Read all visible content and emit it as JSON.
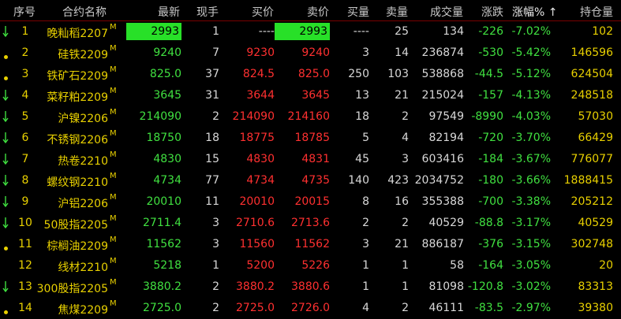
{
  "headers": {
    "seq": "序号",
    "name": "合约名称",
    "last": "最新",
    "vol_now": "现手",
    "bid": "买价",
    "ask": "卖价",
    "bid_vol": "买量",
    "ask_vol": "卖量",
    "volume": "成交量",
    "change": "涨跌",
    "pct": "涨幅%",
    "pct_sort_icon": "arrow-up-icon",
    "oi": "持仓量"
  },
  "colors": {
    "down": "#40e040",
    "up": "#ff3030",
    "label": "#e8d000",
    "neutral": "#d8d8d8"
  },
  "rows": [
    {
      "mark": "down-arrow",
      "seq": "1",
      "name": "晚籼稻2207",
      "flag": "M",
      "last": "2993",
      "last_hl": true,
      "vol_now": "1",
      "bid": "----",
      "ask": "2993",
      "ask_hl": true,
      "bid_vol": "----",
      "ask_vol": "25",
      "volume": "134",
      "change": "-226",
      "pct": "-7.02%",
      "oi": "102"
    },
    {
      "mark": "dot",
      "seq": "2",
      "name": "硅铁2209",
      "flag": "M",
      "last": "9240",
      "vol_now": "7",
      "bid": "9230",
      "ask": "9240",
      "bid_vol": "3",
      "ask_vol": "14",
      "volume": "236874",
      "change": "-530",
      "pct": "-5.42%",
      "oi": "146596"
    },
    {
      "mark": "dot",
      "seq": "3",
      "name": "铁矿石2209",
      "flag": "M",
      "last": "825.0",
      "vol_now": "37",
      "bid": "824.5",
      "ask": "825.0",
      "bid_vol": "250",
      "ask_vol": "103",
      "volume": "538868",
      "change": "-44.5",
      "pct": "-5.12%",
      "oi": "624504"
    },
    {
      "mark": "down-arrow",
      "seq": "4",
      "name": "菜籽粕2209",
      "flag": "M",
      "last": "3645",
      "vol_now": "31",
      "bid": "3644",
      "ask": "3645",
      "bid_vol": "13",
      "ask_vol": "21",
      "volume": "215024",
      "change": "-157",
      "pct": "-4.13%",
      "oi": "248518"
    },
    {
      "mark": "down-arrow",
      "seq": "5",
      "name": "沪镍2206",
      "flag": "M",
      "last": "214090",
      "vol_now": "2",
      "bid": "214090",
      "ask": "214160",
      "bid_vol": "18",
      "ask_vol": "2",
      "volume": "97549",
      "change": "-8990",
      "pct": "-4.03%",
      "oi": "57030"
    },
    {
      "mark": "down-arrow",
      "seq": "6",
      "name": "不锈钢2206",
      "flag": "M",
      "last": "18750",
      "vol_now": "18",
      "bid": "18775",
      "ask": "18785",
      "bid_vol": "5",
      "ask_vol": "4",
      "volume": "82194",
      "change": "-720",
      "pct": "-3.70%",
      "oi": "66429"
    },
    {
      "mark": "down-arrow",
      "seq": "7",
      "name": "热卷2210",
      "flag": "M",
      "last": "4830",
      "vol_now": "15",
      "bid": "4830",
      "ask": "4831",
      "bid_vol": "45",
      "ask_vol": "3",
      "volume": "603416",
      "change": "-184",
      "pct": "-3.67%",
      "oi": "776077"
    },
    {
      "mark": "down-arrow",
      "seq": "8",
      "name": "螺纹钢2210",
      "flag": "M",
      "last": "4734",
      "vol_now": "77",
      "bid": "4734",
      "ask": "4735",
      "bid_vol": "140",
      "ask_vol": "423",
      "volume": "2034752",
      "change": "-180",
      "pct": "-3.66%",
      "oi": "1888415"
    },
    {
      "mark": "down-arrow",
      "seq": "9",
      "name": "沪铝2206",
      "flag": "M",
      "last": "20010",
      "vol_now": "11",
      "bid": "20010",
      "ask": "20015",
      "bid_vol": "8",
      "ask_vol": "16",
      "volume": "355388",
      "change": "-700",
      "pct": "-3.38%",
      "oi": "205212"
    },
    {
      "mark": "down-arrow",
      "seq": "10",
      "name": "50股指2205",
      "flag": "M",
      "last": "2711.4",
      "vol_now": "3",
      "bid": "2710.6",
      "ask": "2713.6",
      "bid_vol": "2",
      "ask_vol": "2",
      "volume": "40529",
      "change": "-88.8",
      "pct": "-3.17%",
      "oi": "40529"
    },
    {
      "mark": "dot",
      "seq": "11",
      "name": "棕榈油2209",
      "flag": "M",
      "last": "11562",
      "vol_now": "3",
      "bid": "11560",
      "ask": "11562",
      "bid_vol": "3",
      "ask_vol": "21",
      "volume": "886187",
      "change": "-376",
      "pct": "-3.15%",
      "oi": "302748"
    },
    {
      "mark": "none",
      "seq": "12",
      "name": "线材2210",
      "flag": "M",
      "last": "5218",
      "vol_now": "1",
      "bid": "5200",
      "ask": "5226",
      "bid_vol": "1",
      "ask_vol": "1",
      "volume": "58",
      "change": "-164",
      "pct": "-3.05%",
      "oi": "20"
    },
    {
      "mark": "down-arrow",
      "seq": "13",
      "name": "300股指2205",
      "flag": "M",
      "last": "3880.2",
      "vol_now": "2",
      "bid": "3880.2",
      "ask": "3880.6",
      "bid_vol": "1",
      "ask_vol": "1",
      "volume": "81098",
      "change": "-120.8",
      "pct": "-3.02%",
      "oi": "83313"
    },
    {
      "mark": "dot",
      "seq": "14",
      "name": "焦煤2209",
      "flag": "M",
      "last": "2725.0",
      "vol_now": "2",
      "bid": "2725.0",
      "ask": "2726.0",
      "bid_vol": "4",
      "ask_vol": "2",
      "volume": "46111",
      "change": "-83.5",
      "pct": "-2.97%",
      "oi": "39380"
    }
  ]
}
